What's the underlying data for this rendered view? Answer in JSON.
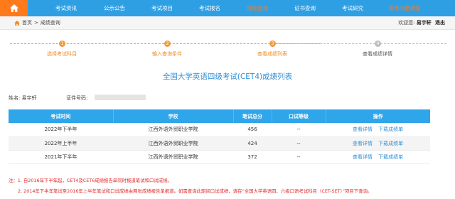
{
  "nav": {
    "items": [
      {
        "label": "考试资讯",
        "state": "normal"
      },
      {
        "label": "公示公告",
        "state": "normal"
      },
      {
        "label": "考试项目",
        "state": "normal"
      },
      {
        "label": "考试报名",
        "state": "normal"
      },
      {
        "label": "成绩查询",
        "state": "active"
      },
      {
        "label": "证书查询",
        "state": "normal"
      },
      {
        "label": "考试研究",
        "state": "normal"
      },
      {
        "label": "高考问卷调查",
        "state": "highlight"
      }
    ],
    "home_icon": "home-icon",
    "colors": {
      "bar": "#2f9fe4",
      "home": "#ff7a1a",
      "active": "#ff7a1a"
    }
  },
  "breadcrumb": {
    "home": "首页",
    "separator": ">",
    "current": "成绩查询",
    "icon": "house-icon"
  },
  "user": {
    "welcome": "欢迎您:",
    "name": "易宇轩",
    "logout": "退出"
  },
  "steps": [
    {
      "num": "1",
      "label": "选择考试科目",
      "status": "done"
    },
    {
      "num": "2",
      "label": "输入查询条件",
      "status": "done"
    },
    {
      "num": "3",
      "label": "查看成绩列表",
      "status": "current"
    },
    {
      "num": "4",
      "label": "查看成绩详情",
      "status": "todo"
    }
  ],
  "page_title": "全国大学英语四级考试(CET4)成绩列表",
  "candidate": {
    "name_label": "姓名:",
    "name": "易宇轩",
    "id_label": "证件号码:"
  },
  "table": {
    "headers": [
      "考试时间",
      "学校",
      "笔试总分",
      "口试等级",
      "操作"
    ],
    "rows": [
      {
        "time": "2022年下半年",
        "school": "江西外语外贸职业学院",
        "score": "456",
        "oral": "--",
        "view": "查看详情",
        "download": "下载成绩单"
      },
      {
        "time": "2022年上半年",
        "school": "江西外语外贸职业学院",
        "score": "424",
        "oral": "--",
        "view": "查看详情",
        "download": "下载成绩单"
      },
      {
        "time": "2021年下半年",
        "school": "江西外语外贸职业学院",
        "score": "372",
        "oral": "--",
        "view": "查看详情",
        "download": "下载成绩单"
      }
    ]
  },
  "notes": [
    "注：1. 自2016年下半年起，CET4及CET6成绩报告单同时报道笔试和口试成绩。",
    "2. 2014年下半年笔试至2016年上半年笔试和口试成绩由两张成绩报告单报道。如需查询此期间口试成绩，请在“全国大学英语四、六级口语考试科目（CET-SET）”项目下查询。"
  ]
}
